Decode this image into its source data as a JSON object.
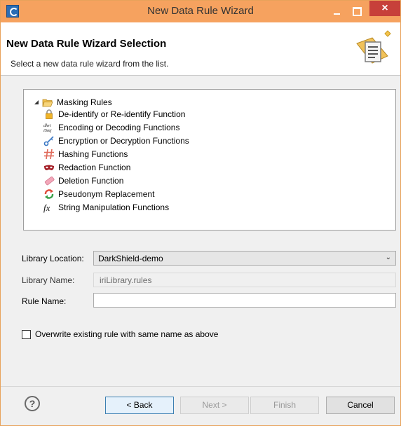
{
  "window": {
    "title": "New Data Rule Wizard",
    "minimize_label": "–",
    "close_label": "×"
  },
  "header": {
    "title": "New Data Rule Wizard Selection",
    "description": "Select a new data rule wizard from the list."
  },
  "tree": {
    "root": {
      "label": "Masking Rules",
      "icon": "folder-open-icon"
    },
    "items": [
      {
        "label": "De-identify or Re-identify Function",
        "icon": "lock-icon"
      },
      {
        "label": "Encoding or Decoding Functions",
        "icon": "encoding-icon",
        "icon_text_top": "dhri",
        "icon_text_bottom": "iSmj"
      },
      {
        "label": "Encryption or Decryption Functions",
        "icon": "key-icon"
      },
      {
        "label": "Hashing Functions",
        "icon": "hash-icon"
      },
      {
        "label": "Redaction Function",
        "icon": "mask-icon"
      },
      {
        "label": "Deletion Function",
        "icon": "eraser-icon"
      },
      {
        "label": "Pseudonym Replacement",
        "icon": "swap-icon"
      },
      {
        "label": "String Manipulation Functions",
        "icon": "function-icon",
        "icon_text": "fx"
      }
    ]
  },
  "form": {
    "library_location_label": "Library Location:",
    "library_location_value": "DarkShield-demo",
    "library_name_label": "Library Name:",
    "library_name_value": "iriLibrary.rules",
    "rule_name_label": "Rule Name:",
    "rule_name_value": "",
    "overwrite_label": "Overwrite existing rule with same name as above",
    "overwrite_checked": false
  },
  "buttons": {
    "help": "?",
    "back": "< Back",
    "next": "Next >",
    "finish": "Finish",
    "cancel": "Cancel"
  },
  "colors": {
    "titlebar": "#f6a25f",
    "close_button": "#c7403a",
    "default_button_border": "#3c7fb1"
  }
}
